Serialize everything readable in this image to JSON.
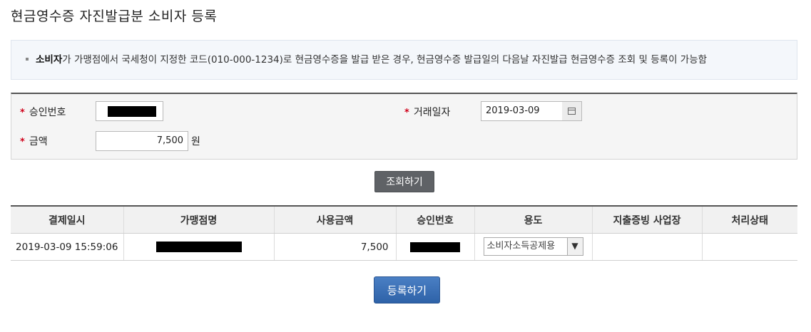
{
  "page": {
    "title": "현금영수증 자진발급분 소비자 등록"
  },
  "notice": {
    "bold": "소비자",
    "text": "가 가맹점에서 국세청이 지정한 코드(010-000-1234)로 현금영수증을 발급 받은 경우, 현금영수증 발급일의 다음날 자진발급 현금영수증 조회 및 등록이 가능함"
  },
  "form": {
    "approval_label": "승인번호",
    "date_label": "거래일자",
    "date_value": "2019-03-09",
    "amount_label": "금액",
    "amount_value": "7,500",
    "amount_unit": "원"
  },
  "buttons": {
    "search": "조회하기",
    "register": "등록하기"
  },
  "table": {
    "headers": [
      "결제일시",
      "가맹점명",
      "사용금액",
      "승인번호",
      "용도",
      "지출증빙 사업장",
      "처리상태"
    ],
    "rows": [
      {
        "datetime": "2019-03-09 15:59:06",
        "amount": "7,500",
        "usage": "소비자소득공제용"
      }
    ]
  }
}
